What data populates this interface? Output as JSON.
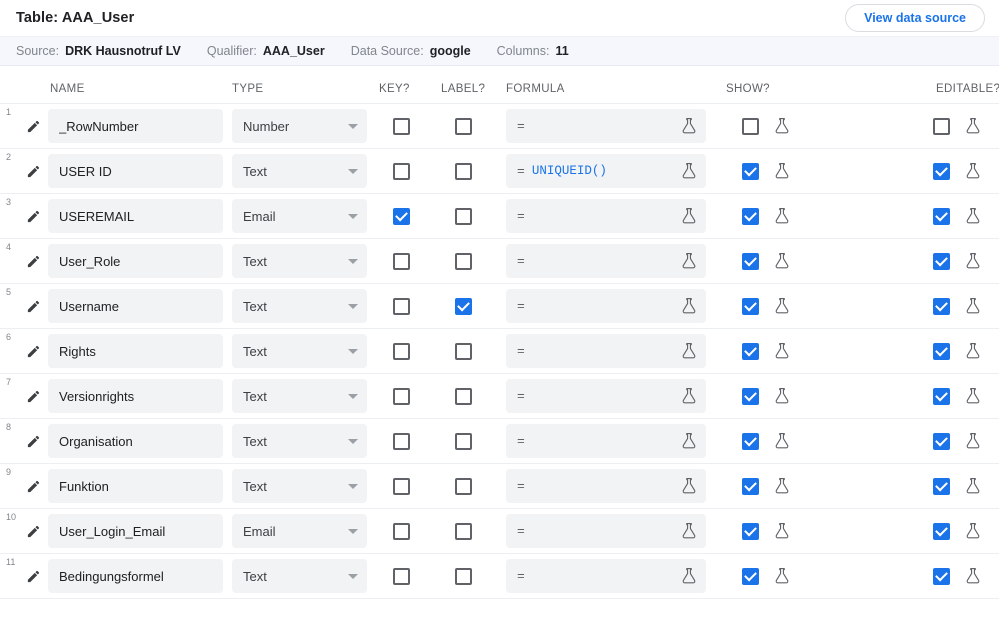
{
  "header": {
    "title": "Table: AAA_User",
    "view_data_source_label": "View data source"
  },
  "source_bar": {
    "items": [
      {
        "label": "Source:",
        "value": "DRK Hausnotruf LV"
      },
      {
        "label": "Qualifier:",
        "value": "AAA_User"
      },
      {
        "label": "Data Source:",
        "value": "google"
      },
      {
        "label": "Columns:",
        "value": "11"
      }
    ]
  },
  "table": {
    "columns": {
      "name": "NAME",
      "type": "TYPE",
      "key": "KEY?",
      "label": "LABEL?",
      "formula": "FORMULA",
      "show": "SHOW?",
      "editable": "EDITABLE?"
    },
    "formula_prefix": "=",
    "rows": [
      {
        "index": "1",
        "name": "_RowNumber",
        "type": "Number",
        "key": false,
        "label": false,
        "formula": "",
        "show": false,
        "editable": false
      },
      {
        "index": "2",
        "name": "USER ID",
        "type": "Text",
        "key": false,
        "label": false,
        "formula": "UNIQUEID()",
        "show": true,
        "editable": true
      },
      {
        "index": "3",
        "name": "USEREMAIL",
        "type": "Email",
        "key": true,
        "label": false,
        "formula": "",
        "show": true,
        "editable": true
      },
      {
        "index": "4",
        "name": "User_Role",
        "type": "Text",
        "key": false,
        "label": false,
        "formula": "",
        "show": true,
        "editable": true
      },
      {
        "index": "5",
        "name": "Username",
        "type": "Text",
        "key": false,
        "label": true,
        "formula": "",
        "show": true,
        "editable": true
      },
      {
        "index": "6",
        "name": "Rights",
        "type": "Text",
        "key": false,
        "label": false,
        "formula": "",
        "show": true,
        "editable": true
      },
      {
        "index": "7",
        "name": "Versionrights",
        "type": "Text",
        "key": false,
        "label": false,
        "formula": "",
        "show": true,
        "editable": true
      },
      {
        "index": "8",
        "name": "Organisation",
        "type": "Text",
        "key": false,
        "label": false,
        "formula": "",
        "show": true,
        "editable": true
      },
      {
        "index": "9",
        "name": "Funktion",
        "type": "Text",
        "key": false,
        "label": false,
        "formula": "",
        "show": true,
        "editable": true
      },
      {
        "index": "10",
        "name": "User_Login_Email",
        "type": "Email",
        "key": false,
        "label": false,
        "formula": "",
        "show": true,
        "editable": true
      },
      {
        "index": "11",
        "name": "Bedingungsformel",
        "type": "Text",
        "key": false,
        "label": false,
        "formula": "",
        "show": true,
        "editable": true
      }
    ]
  },
  "icons": {
    "edit": "pencil-icon",
    "formula_builder": "flask-icon",
    "dropdown": "chevron-down-icon"
  },
  "colors": {
    "accent": "#1a73e8",
    "field_bg": "#f1f3f4",
    "source_bar_bg": "#f5f7fd",
    "text": "#202124",
    "muted": "#5f6368"
  }
}
